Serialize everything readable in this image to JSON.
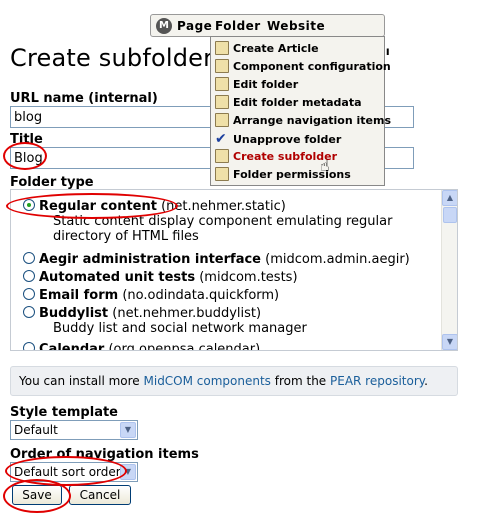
{
  "page": {
    "title": "Create subfolder",
    "title_tail": "\""
  },
  "url_field": {
    "label": "URL name (internal)",
    "value": "blog"
  },
  "title_field": {
    "label": "Title",
    "value": "Blog"
  },
  "folder_type": {
    "label": "Folder type",
    "options": [
      {
        "name": "Regular content",
        "id": "(net.nehmer.static)",
        "desc": "Static content display component emulating regular directory of HTML files",
        "checked": true
      },
      {
        "name": "Aegir administration interface",
        "id": "(midcom.admin.aegir)",
        "desc": "",
        "checked": false
      },
      {
        "name": "Automated unit tests",
        "id": "(midcom.tests)",
        "desc": "",
        "checked": false
      },
      {
        "name": "Email form",
        "id": "(no.odindata.quickform)",
        "desc": "",
        "checked": false
      },
      {
        "name": "Buddylist",
        "id": "(net.nehmer.buddylist)",
        "desc": "Buddy list and social network manager",
        "checked": false
      },
      {
        "name": "Calendar",
        "id": "(org.openpsa.calendar)",
        "desc": "",
        "checked": false
      }
    ]
  },
  "info": {
    "prefix": "You can install more ",
    "link1": "MidCOM components",
    "middle": " from the ",
    "link2": "PEAR repository",
    "suffix": "."
  },
  "style_template": {
    "label": "Style template",
    "selected": "Default"
  },
  "nav_order": {
    "label": "Order of navigation items",
    "selected": "Default sort order"
  },
  "buttons": {
    "save": "Save",
    "cancel": "Cancel"
  },
  "toolbar": {
    "logo": "M",
    "menus": [
      "Page",
      "Folder",
      "Website"
    ]
  },
  "folder_menu": {
    "items": [
      "Create Article",
      "Component configuration",
      "Edit folder",
      "Edit folder metadata",
      "Arrange navigation items",
      "Unapprove folder",
      "Create subfolder",
      "Folder permissions"
    ]
  },
  "colors": {
    "annotation": "#e00000",
    "link": "#1a5e9a",
    "menu_highlight": "#b00000"
  }
}
